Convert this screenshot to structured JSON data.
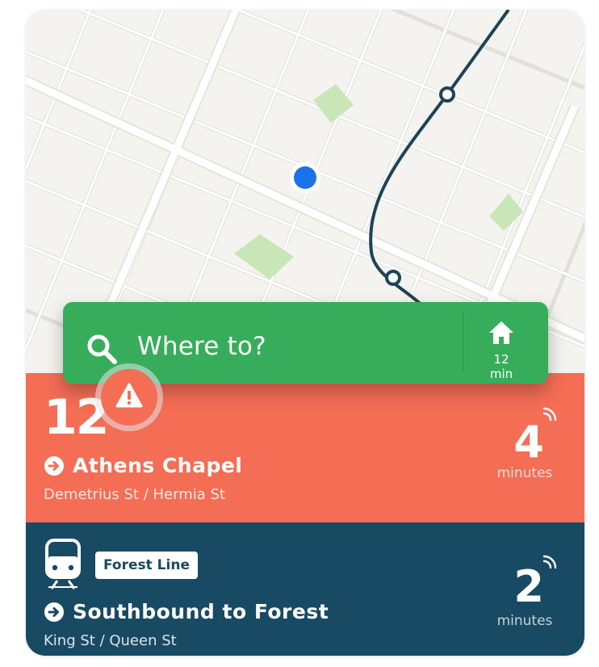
{
  "search": {
    "placeholder": "Where to?",
    "home_eta": "12 min"
  },
  "nearby": [
    {
      "type": "bus",
      "route": "12",
      "has_alert": true,
      "destination": "Athens Chapel",
      "stop": "Demetrius St / Hermia St",
      "minutes": "4",
      "minutes_label": "minutes",
      "color": "#f46d55"
    },
    {
      "type": "train",
      "line": "Forest Line",
      "destination": "Southbound to Forest",
      "stop": "King St / Queen St",
      "minutes": "2",
      "minutes_label": "minutes",
      "color": "#184a64"
    }
  ],
  "colors": {
    "search_bar": "#37ad5b",
    "user_location": "#1a73e8",
    "transit_line": "#1e4357",
    "map_background": "#f4f3ef",
    "park": "#c9e6b9"
  },
  "icons": [
    "search-icon",
    "home-icon",
    "alert-icon",
    "arrow-right-icon",
    "realtime-icon",
    "tram-icon"
  ]
}
